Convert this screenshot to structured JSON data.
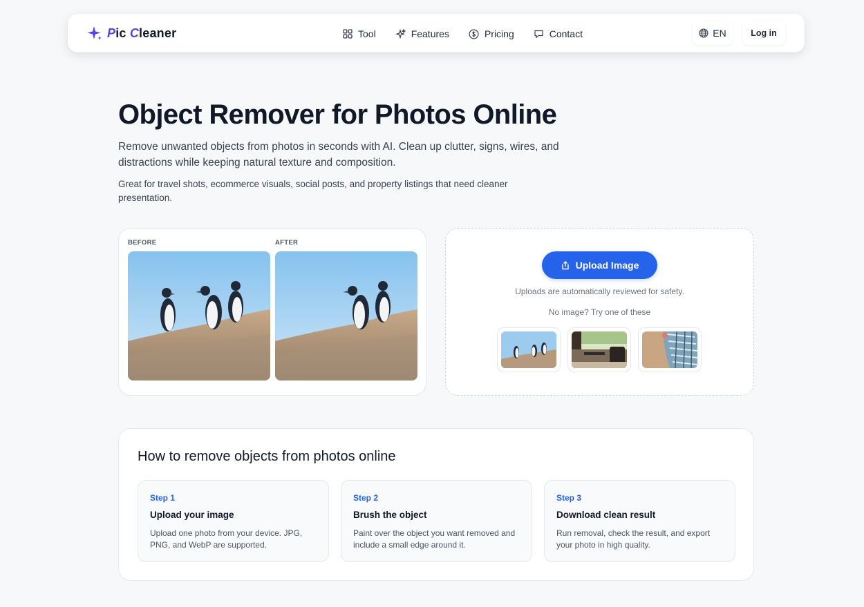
{
  "brand": {
    "name_p": "P",
    "name_ic": "ic ",
    "name_c": "C",
    "name_leaner": "leaner",
    "accent": "#4f46e5"
  },
  "nav": {
    "items": [
      {
        "label": "Tool",
        "icon": "grid-icon"
      },
      {
        "label": "Features",
        "icon": "sparkles-icon"
      },
      {
        "label": "Pricing",
        "icon": "dollar-circle-icon"
      },
      {
        "label": "Contact",
        "icon": "chat-icon"
      }
    ],
    "language": "EN",
    "login": "Log in"
  },
  "hero": {
    "title": "Object Remover for Photos Online",
    "subtitle": "Remove unwanted objects from photos in seconds with AI. Clean up clutter, signs, wires, and distractions while keeping natural texture and composition.",
    "subtitle2": "Great for travel shots, ecommerce visuals, social posts, and property listings that need cleaner presentation."
  },
  "compare": {
    "before_label": "BEFORE",
    "after_label": "AFTER"
  },
  "upload": {
    "button_label": "Upload Image",
    "safety_note": "Uploads are automatically reviewed for safety.",
    "sample_prompt": "No image? Try one of these",
    "samples": [
      "penguins-sample",
      "living-room-sample",
      "fabric-sample"
    ],
    "button_color": "#2563eb"
  },
  "howto": {
    "title": "How to remove objects from photos online",
    "steps": [
      {
        "num": "Step 1",
        "title": "Upload your image",
        "desc": "Upload one photo from your device. JPG, PNG, and WebP are supported."
      },
      {
        "num": "Step 2",
        "title": "Brush the object",
        "desc": "Paint over the object you want removed and include a small edge around it."
      },
      {
        "num": "Step 3",
        "title": "Download clean result",
        "desc": "Run removal, check the result, and export your photo in high quality."
      }
    ]
  }
}
